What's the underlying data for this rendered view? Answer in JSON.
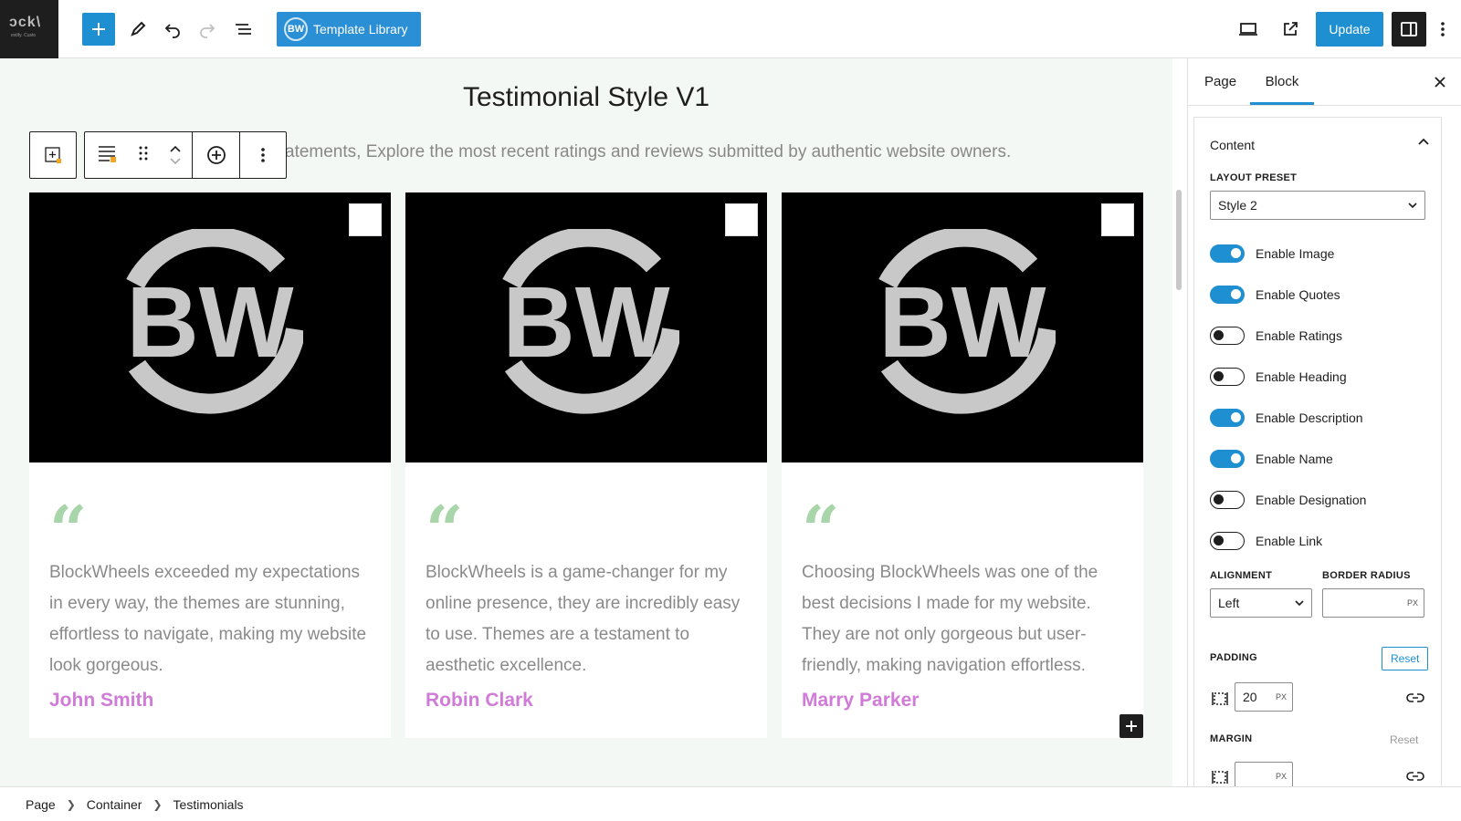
{
  "topbar": {
    "site_logo_main": "ɔck\\",
    "site_logo_sub": "extify. Custo",
    "template_library_label": "Template Library",
    "template_logo": "BW",
    "update_label": "Update"
  },
  "canvas": {
    "heading": "Testimonial Style V1",
    "subtext": "atements, Explore the most recent ratings and reviews submitted by authentic website owners.",
    "quote_mark": "“",
    "logo_text": "BW",
    "cards": [
      {
        "description": "BlockWheels exceeded my expectations in every way, the themes are stunning, effortless to navigate, making my website look gorgeous.",
        "name": "John Smith"
      },
      {
        "description": "BlockWheels is a game-changer for my online presence, they are incredibly easy to use. Themes are a testament to aesthetic excellence.",
        "name": "Robin Clark"
      },
      {
        "description": "Choosing BlockWheels was one of the best decisions I made for my website. They are not only gorgeous but user-friendly, making navigation effortless.",
        "name": "Marry Parker"
      }
    ]
  },
  "breadcrumb": [
    "Page",
    "Container",
    "Testimonials"
  ],
  "sidebar": {
    "tabs": [
      "Page",
      "Block"
    ],
    "panel_title": "Content",
    "layout_preset_label": "LAYOUT PRESET",
    "layout_preset_value": "Style 2",
    "toggles": [
      {
        "label": "Enable Image",
        "on": true
      },
      {
        "label": "Enable Quotes",
        "on": true
      },
      {
        "label": "Enable Ratings",
        "on": false
      },
      {
        "label": "Enable Heading",
        "on": false
      },
      {
        "label": "Enable Description",
        "on": true
      },
      {
        "label": "Enable Name",
        "on": true
      },
      {
        "label": "Enable Designation",
        "on": false
      },
      {
        "label": "Enable Link",
        "on": false
      }
    ],
    "alignment_label": "ALIGNMENT",
    "alignment_value": "Left",
    "border_radius_label": "BORDER RADIUS",
    "border_radius_value": "",
    "unit": "PX",
    "padding_label": "PADDING",
    "padding_value": "20",
    "reset_label": "Reset",
    "margin_label": "MARGIN",
    "margin_value": ""
  },
  "colors": {
    "accent": "#1e8fd1",
    "name": "#d17bd8",
    "quote": "#a8d5aa",
    "canvas_bg": "#f4f8f5"
  }
}
